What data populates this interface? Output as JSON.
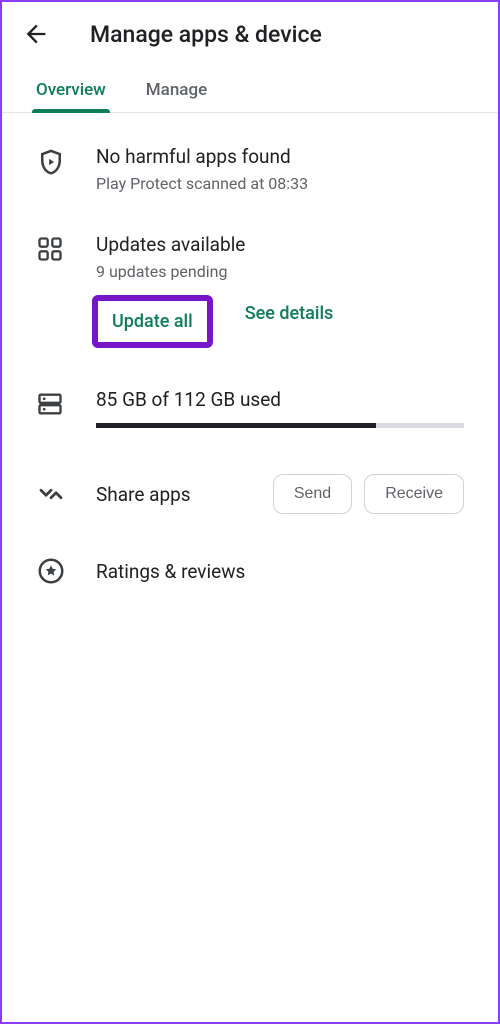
{
  "header": {
    "title": "Manage apps & device"
  },
  "tabs": {
    "overview": "Overview",
    "manage": "Manage"
  },
  "protect": {
    "title": "No harmful apps found",
    "subtitle": "Play Protect scanned at 08:33"
  },
  "updates": {
    "title": "Updates available",
    "subtitle": "9 updates pending",
    "update_all": "Update all",
    "see_details": "See details"
  },
  "storage": {
    "label": "85 GB of 112 GB used",
    "percent": 76
  },
  "share": {
    "title": "Share apps",
    "send": "Send",
    "receive": "Receive"
  },
  "ratings": {
    "title": "Ratings & reviews"
  }
}
